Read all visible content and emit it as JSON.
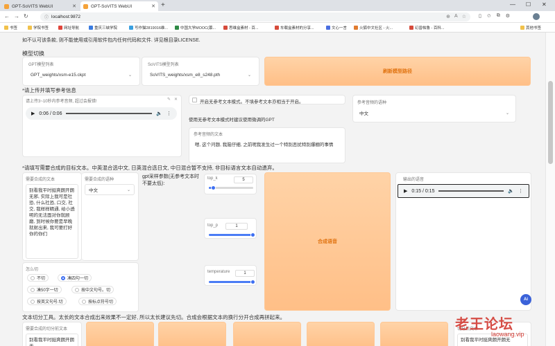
{
  "browser": {
    "tabs": [
      {
        "label": "GPT-SoVITS WebUI",
        "active": false
      },
      {
        "label": "GPT-SoVITS WebUI",
        "active": true
      }
    ],
    "new_tab": "+",
    "url": "localhost:9872",
    "bookmarks": [
      "书签",
      "学院书签",
      "网址导航",
      "重庆三峡学院",
      "写作猫2819016维...",
      "中国大学MOOC(慕...",
      "思维盒素材 - 百...",
      "车载盒素材的分享...",
      "文心一言",
      "火狐中文社区 - 火...",
      "幻兽帕鲁 - 百科...",
      "其他书签"
    ]
  },
  "page": {
    "license_note": "如不认可该条款, 则不能使用或引用软件包内任何代码和文件. 详见根目录LICENSE.",
    "model_switch": {
      "heading": "模型切换",
      "gpt_label": "GPT模型列表",
      "gpt_value": "GPT_weights/xsm-e15.ckpt",
      "sovits_label": "SoVITS模型列表",
      "sovits_value": "SoVITS_weights/xsm_e8_s248.pth",
      "refresh_button": "刷新模型路径"
    },
    "reference": {
      "heading": "*请上传并填写参考信息",
      "audio_label": "请上传3~10秒内参考音频, 超过会报错!",
      "audio_time": "0:06 / 0:06",
      "no_ref_checkbox": "开启无参考文本模式。不填参考文本亦相当于开启。",
      "tip": "使用无参考文本模式时建议使用微调的GPT",
      "ref_text_label": "参考音频的文本",
      "ref_text_value": "嗯, 这个问题, 我脑仔细, 之前呢我发生过一个特别恶扰特别爆棚的事情",
      "ref_lang_label": "参考音频的语种",
      "ref_lang_value": "中文"
    },
    "target": {
      "heading": "*请填写需要合成的目标文本。中英混合选中文, 日英混合选日文, 中日混合暂不支持, 非目标语言文本自动遗弃。",
      "text_label": "需要合成的文本",
      "text_value": "别看我平时挺爽朗开朗无邪, 实际上我可是社恐, 什么社恐, 口交, 社交, 我样样精通, 给小透明的无法面对你就顾磨, 到时候你要是早晚就射出来, 我可要打好你的你们",
      "lang_label": "需要合成的语种",
      "lang_value": "中文",
      "gpt_params_label": "gpt采样参数(无参考文本时不要太低):",
      "top_k_label": "top_k",
      "top_k_value": 5,
      "top_p_label": "top_p",
      "top_p_value": 1,
      "temperature_label": "temperature",
      "temperature_value": 1,
      "synth_button": "合成语音",
      "output_label": "输出的语音",
      "output_time": "0:15 / 0:15",
      "split_heading": "怎么切",
      "split_options": [
        "不切",
        "凑四句一切",
        "凑50字一切",
        "按中文句号。切",
        "按英文句号.切",
        "按标点符号切"
      ],
      "split_selected": "凑四句一切"
    },
    "split_tool": {
      "heading": "文本切分工具。太长的文本合成出来效果不一定好, 所以太长建议先切。合成会根据文本的换行分开合成再拼起来。",
      "input_label": "需要合成的切分前文本",
      "input_value": "别看我平时挺爽朗开朗无",
      "output_label": "切分后文本",
      "output_value": "别看我平时挺爽朗开朗无"
    },
    "watermark": "老王论坛",
    "watermark_site": "laowang.vip",
    "ai_badge": "Ai"
  }
}
